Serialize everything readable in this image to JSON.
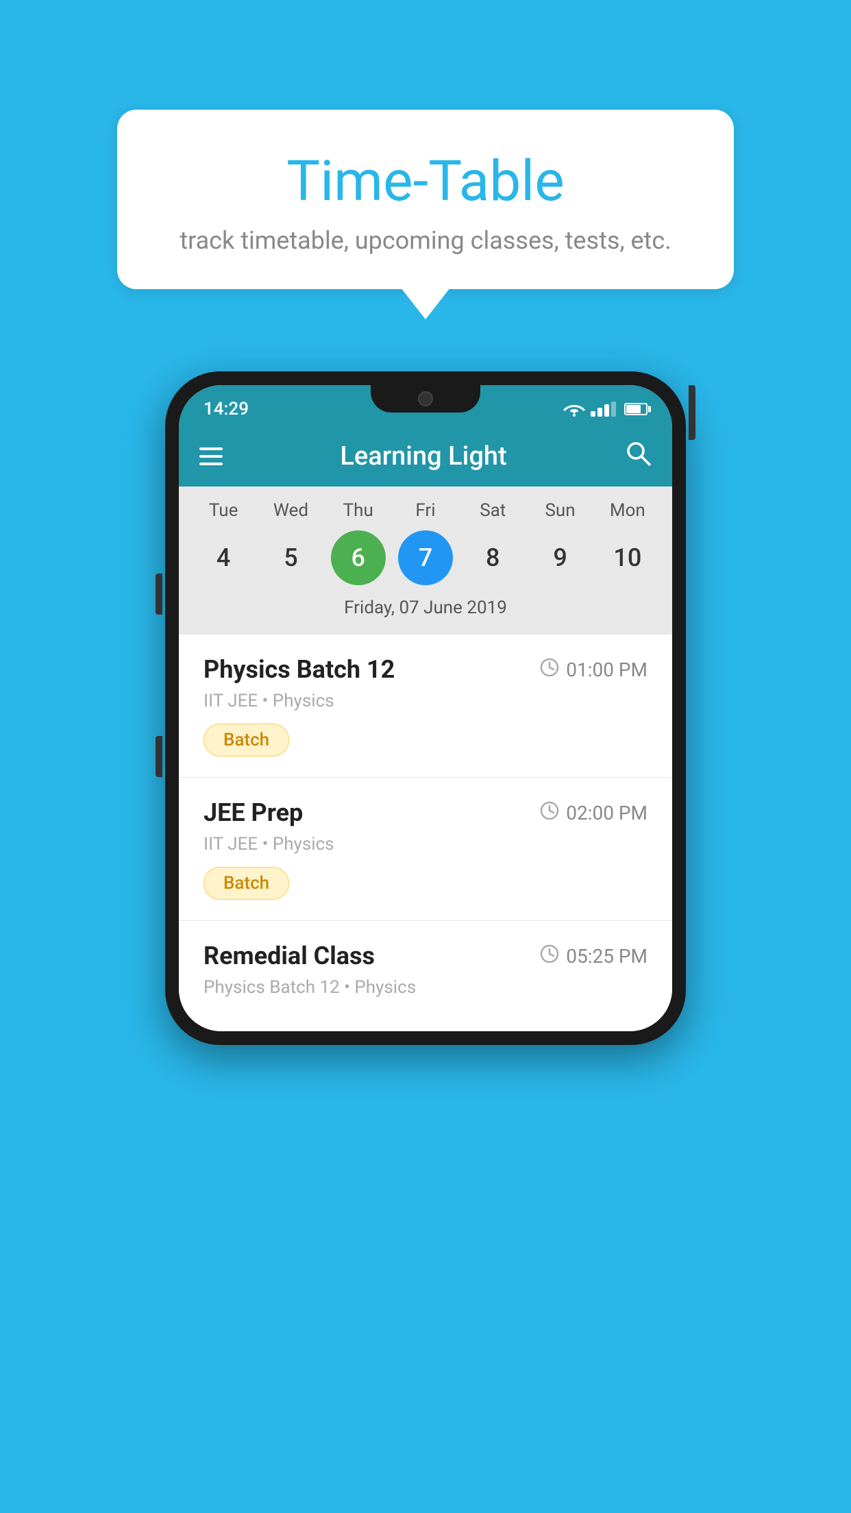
{
  "bubble": {
    "title": "Time-Table",
    "subtitle": "track timetable, upcoming classes, tests, etc."
  },
  "phone": {
    "status_bar": {
      "time": "14:29"
    },
    "header": {
      "title": "Learning Light",
      "menu_icon": "hamburger-icon",
      "search_icon": "search-icon"
    },
    "calendar": {
      "days": [
        "Tue",
        "Wed",
        "Thu",
        "Fri",
        "Sat",
        "Sun",
        "Mon"
      ],
      "numbers": [
        "4",
        "5",
        "6",
        "7",
        "8",
        "9",
        "10"
      ],
      "today_index": 2,
      "selected_index": 3,
      "selected_date_label": "Friday, 07 June 2019"
    },
    "schedule": [
      {
        "title": "Physics Batch 12",
        "time": "01:00 PM",
        "meta": "IIT JEE • Physics",
        "badge": "Batch"
      },
      {
        "title": "JEE Prep",
        "time": "02:00 PM",
        "meta": "IIT JEE • Physics",
        "badge": "Batch"
      },
      {
        "title": "Remedial Class",
        "time": "05:25 PM",
        "meta": "Physics Batch 12 • Physics",
        "badge": ""
      }
    ]
  }
}
